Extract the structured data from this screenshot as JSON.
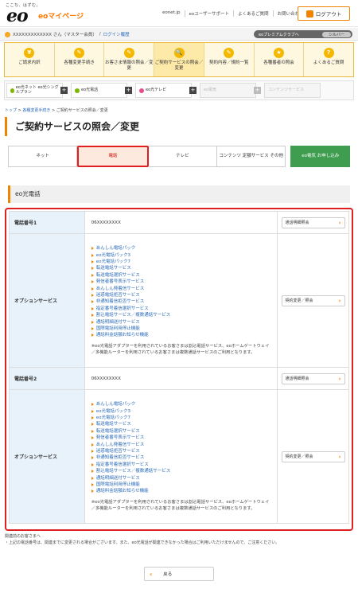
{
  "header": {
    "tagline": "ここち、はずむ。",
    "logo": "eo",
    "mypage": "eoマイページ",
    "links": [
      "eonet.jp",
      "eoユーザーサポート",
      "よくあるご質問",
      "お問い合わせ"
    ],
    "logout": "ログアウト"
  },
  "user": {
    "name": "XXXXXXXXXXXXX さん（マスター会員）",
    "login_history": "ログイン履歴",
    "premium": "eoプレミアムクラブへ",
    "rank": "シルバー"
  },
  "nav": [
    {
      "icon": "¥",
      "label": "ご請求内訳"
    },
    {
      "icon": "✎",
      "label": "各種変更手続き"
    },
    {
      "icon": "✎",
      "label": "お客さま情報の照会／変更"
    },
    {
      "icon": "🔍",
      "label": "ご契約サービスの照会／変更"
    },
    {
      "icon": "✎",
      "label": "契約内容／規約一覧"
    },
    {
      "icon": "★",
      "label": "各種番者の照会"
    },
    {
      "icon": "?",
      "label": "よくあるご質問"
    }
  ],
  "services": [
    {
      "label": "eo光ネット eo光シングルプラン",
      "dim": false
    },
    {
      "label": "eo光電話",
      "dim": false
    },
    {
      "label": "eo光テレビ",
      "dim": false
    },
    {
      "label": "eo電気",
      "dim": true
    },
    {
      "label": "コンテンツサービス",
      "dim": true
    }
  ],
  "breadcrumb": {
    "home": "トップ",
    "mid": "各種変更手続き",
    "current": "ご契約サービスの照会／変更"
  },
  "page_title": "ご契約サービスの照会／変更",
  "tabs": [
    "ネット",
    "電話",
    "テレビ",
    "コンテンツ 定額サービス その他",
    "eo電気 お申し込み"
  ],
  "section_title": "eo光電話",
  "phones": [
    {
      "label": "電話番号1",
      "number": "06XXXXXXXX",
      "history_btn": "通話明細照会",
      "option_label": "オプションサービス",
      "change_btn": "契約変更／照会",
      "options": [
        "あんしん電話パック",
        "eo光電話パック3",
        "eo光電話パック7",
        "転送電話サービス",
        "転送電話選択サービス",
        "発信者番号表示サービス",
        "あんしん発着信サービス",
        "迷惑電話拒否サービス",
        "非通知着信拒否サービス",
        "指定番号着信選択サービス",
        "割込電話サービス／複数通話サービス",
        "通話明細送付サービス",
        "国際電話利用停止機能",
        "通話料金話額お知らせ機能"
      ],
      "note": "※eo光電話アダプターを利用されているお客さまは割込電話サービス、eoホームゲートウェイ／多機能ルーターを利用されているお客さまは複数通話サービスのご利用となります。"
    },
    {
      "label": "電話番号2",
      "number": "06XXXXXXXX",
      "history_btn": "通話明細照会",
      "option_label": "オプションサービス",
      "change_btn": "契約変更／照会",
      "options": [
        "あんしん電話パック",
        "eo光電話パック3",
        "eo光電話パック7",
        "転送電話サービス",
        "転送電話選択サービス",
        "発信者番号表示サービス",
        "あんしん発着信サービス",
        "迷惑電話拒否サービス",
        "非通知着信拒否サービス",
        "指定番号着信選択サービス",
        "割込電話サービス／複数通話サービス",
        "通話明細送付サービス",
        "国際電話利用停止機能",
        "通話料金話額お知らせ機能"
      ],
      "note": "※eo光電話アダプターを利用されているお客さまは割込電話サービス、eoホームゲートウェイ／多機能ルーターを利用されているお客さまは複数通話サービスのご利用となります。"
    }
  ],
  "footer_note_1": "関連前のお客さまへ",
  "footer_note_2": "・上記の電話番号は、関連までに変更される場合がございます。また、eo光電話が関連できなかった場合はご利用いただけませんので、ご注意ください。",
  "back_btn": "戻る",
  "colors": {
    "accent": "#f08300",
    "highlight": "#e02020",
    "link": "#2a6ab8"
  }
}
